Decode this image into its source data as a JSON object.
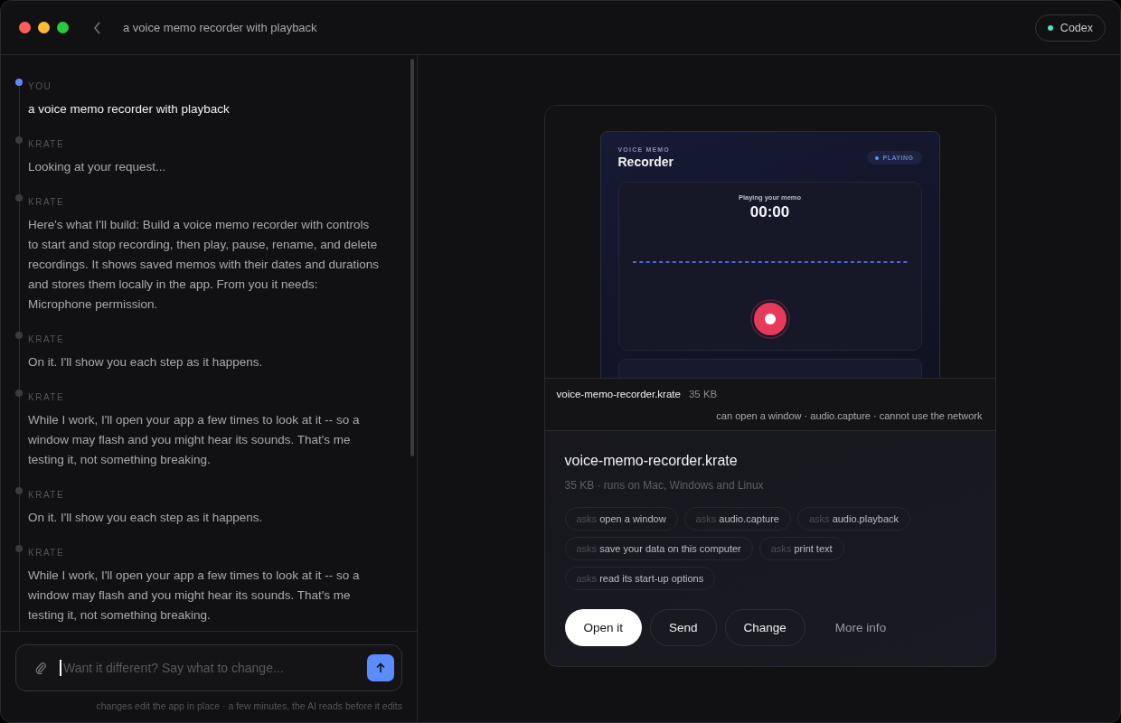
{
  "window": {
    "title": "a voice memo recorder with playback",
    "badge": {
      "label": "Codex",
      "color": "#4fe3c1"
    }
  },
  "chat": {
    "messages": [
      {
        "kind": "user",
        "role": "YOU",
        "text": "a voice memo recorder with playback"
      },
      {
        "kind": "assistant",
        "role": "KRATE",
        "text": "Looking at your request..."
      },
      {
        "kind": "assistant",
        "role": "KRATE",
        "text": "Here's what I'll build: Build a voice memo recorder with controls to start and stop recording, then play, pause, rename, and delete recordings. It shows saved memos with their dates and durations and stores them locally in the app. From you it needs: Microphone permission."
      },
      {
        "kind": "assistant",
        "role": "KRATE",
        "text": "On it. I'll show you each step as it happens."
      },
      {
        "kind": "assistant",
        "role": "KRATE",
        "text": "While I work, I'll open your app a few times to look at it -- so a window may flash and you might hear its sounds. That's me testing it, not something breaking."
      },
      {
        "kind": "assistant",
        "role": "KRATE",
        "text": "On it. I'll show you each step as it happens."
      },
      {
        "kind": "assistant",
        "role": "KRATE",
        "text": "While I work, I'll open your app a few times to look at it -- so a window may flash and you might hear its sounds. That's me testing it, not something breaking."
      }
    ],
    "composer": {
      "placeholder": "Want it different? Say what to change...",
      "hint": "changes edit the app in place · a few minutes, the AI reads before it edits"
    }
  },
  "preview": {
    "app": {
      "eyebrow": "VOICE MEMO",
      "title": "Recorder",
      "status": "PLAYING",
      "caption": "Playing your memo",
      "time": "00:00"
    },
    "file_name": "voice-memo-recorder.krate",
    "file_size": "35 KB",
    "capabilities": "can open a window · audio.capture · cannot use the network"
  },
  "details": {
    "title": "voice-memo-recorder.krate",
    "subtitle": "35 KB · runs on Mac, Windows and Linux",
    "permissions": [
      {
        "prefix": "asks",
        "label": "open a window"
      },
      {
        "prefix": "asks",
        "label": "audio.capture"
      },
      {
        "prefix": "asks",
        "label": "audio.playback"
      },
      {
        "prefix": "asks",
        "label": "save your data on this computer"
      },
      {
        "prefix": "asks",
        "label": "print text"
      },
      {
        "prefix": "asks",
        "label": "read its start-up options"
      }
    ],
    "actions": [
      {
        "kind": "primary",
        "label": "Open it"
      },
      {
        "kind": "outline",
        "label": "Send"
      },
      {
        "kind": "outline",
        "label": "Change"
      },
      {
        "kind": "plain",
        "label": "More info"
      }
    ]
  }
}
